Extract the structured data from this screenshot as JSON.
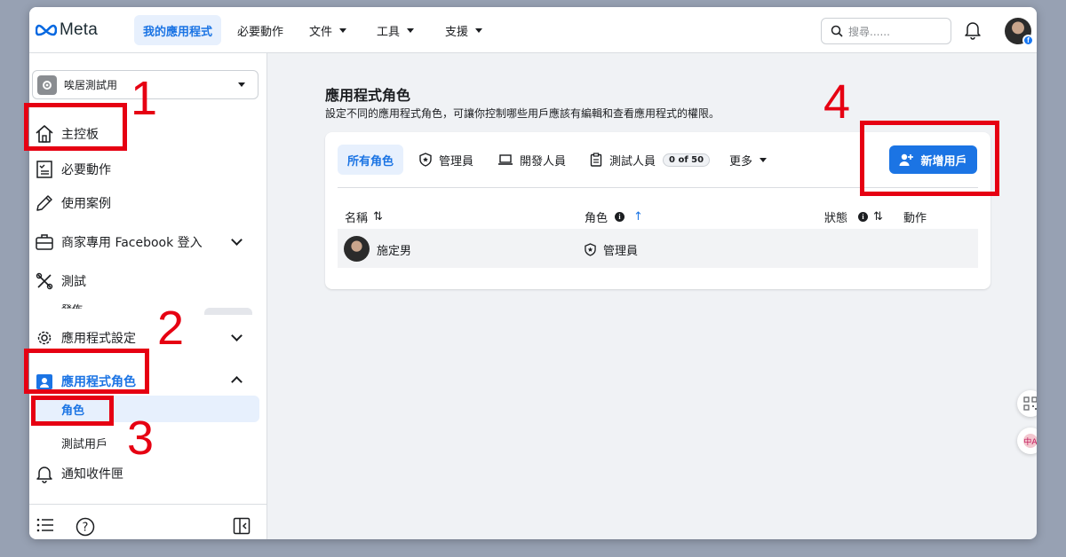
{
  "brand": {
    "logo_text": "Meta"
  },
  "topnav": {
    "tabs": [
      {
        "label": "我的應用程式",
        "active": true
      },
      {
        "label": "必要動作"
      },
      {
        "label": "文件",
        "has_dropdown": true
      },
      {
        "label": "工具",
        "has_dropdown": true
      },
      {
        "label": "支援",
        "has_dropdown": true
      }
    ],
    "search_placeholder": "搜尋......"
  },
  "sidebar": {
    "app_name": "唉居測試用",
    "items": [
      {
        "label": "主控板",
        "icon": "home-icon"
      },
      {
        "label": "必要動作",
        "icon": "checklist-icon"
      },
      {
        "label": "使用案例",
        "icon": "pencil-icon"
      },
      {
        "label": "商家專用 Facebook 登入",
        "icon": "briefcase-icon",
        "expand": "down"
      },
      {
        "label": "測試",
        "icon": "tools-icon"
      },
      {
        "label": "應用程式設定",
        "icon": "gear-icon",
        "expand": "down"
      },
      {
        "label": "應用程式角色",
        "icon": "roles-icon",
        "expand": "up",
        "active": true
      }
    ],
    "overlap_text": "發佈",
    "subitems": [
      {
        "label": "角色",
        "active": true
      },
      {
        "label": "測試用戶"
      }
    ],
    "notifications_label": "通知收件匣"
  },
  "main": {
    "title": "應用程式角色",
    "description": "設定不同的應用程式角色，可讓你控制哪些用戶應該有編輯和查看應用程式的權限。",
    "role_tabs": [
      {
        "label": "所有角色",
        "active": true
      },
      {
        "label": "管理員",
        "icon": "shield-icon"
      },
      {
        "label": "開發人員",
        "icon": "laptop-icon"
      },
      {
        "label": "測試人員",
        "icon": "clipboard-icon",
        "badge": "0 of 50"
      },
      {
        "label": "更多",
        "has_dropdown": true
      }
    ],
    "add_user_label": "新增用戶",
    "columns": {
      "name": "名稱",
      "role": "角色",
      "status": "狀態",
      "action": "動作"
    },
    "rows": [
      {
        "name": "施定男",
        "role": "管理員"
      }
    ]
  },
  "annotations": {
    "numbers": [
      "1",
      "2",
      "3",
      "4"
    ],
    "color": "#e60012"
  },
  "colors": {
    "accent": "#1b74e4",
    "annotation": "#e60012"
  }
}
